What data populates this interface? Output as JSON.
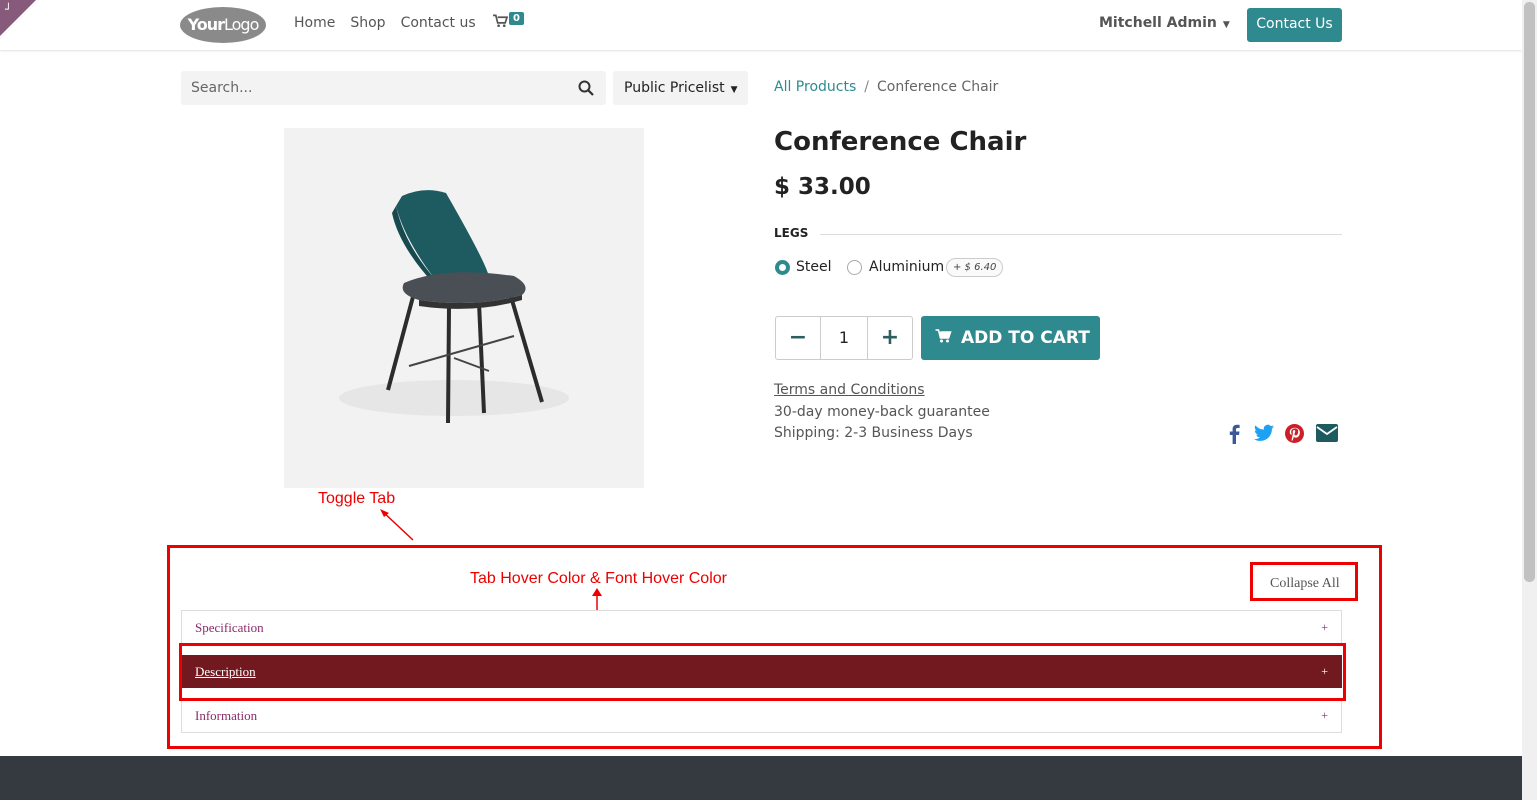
{
  "header": {
    "logo_text_bold": "Your",
    "logo_text_light": "Logo",
    "nav": [
      "Home",
      "Shop",
      "Contact us"
    ],
    "cart_count": "0",
    "user_name": "Mitchell Admin",
    "contact_button": "Contact Us"
  },
  "search": {
    "placeholder": "Search...",
    "pricelist": "Public Pricelist"
  },
  "breadcrumb": {
    "parent": "All Products",
    "separator": "/",
    "current": "Conference Chair"
  },
  "product": {
    "title": "Conference Chair",
    "price": "$ 33.00",
    "attribute_label": "LEGS",
    "options": [
      {
        "label": "Steel",
        "selected": true
      },
      {
        "label": "Aluminium",
        "selected": false,
        "extra": "+ $ 6.40"
      }
    ],
    "quantity": "1",
    "add_to_cart": "ADD TO CART",
    "terms": "Terms and Conditions",
    "guarantee": "30-day money-back guarantee",
    "shipping": "Shipping: 2-3 Business Days"
  },
  "annotations": {
    "toggle_tab": "Toggle Tab",
    "hover": "Tab Hover Color & Font Hover Color"
  },
  "tabs": {
    "collapse_all": "Collapse All",
    "items": [
      {
        "label": "Specification",
        "icon": "+"
      },
      {
        "label": "Description",
        "icon": "+"
      },
      {
        "label": "Information",
        "icon": "+"
      }
    ]
  },
  "colors": {
    "accent": "#2e8a8f",
    "tab_hover_bg": "#71191e",
    "tab_font": "#8b2b6b",
    "annotation": "#ee0000",
    "footer": "#343a40"
  }
}
